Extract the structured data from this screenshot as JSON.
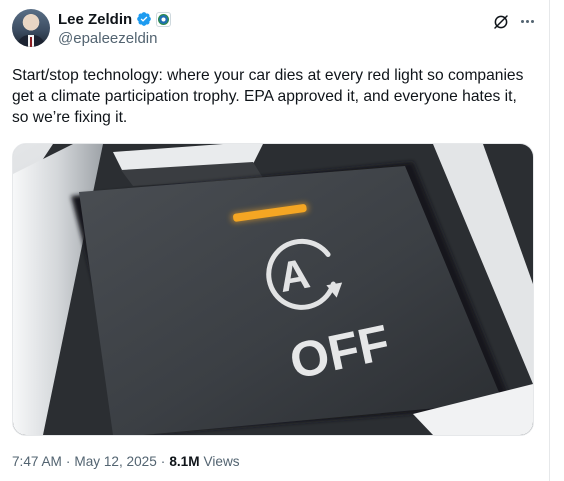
{
  "author": {
    "display_name": "Lee Zeldin",
    "handle": "@epaleezeldin"
  },
  "tweet": {
    "text": "Start/stop technology: where your car dies at every red light so companies get a climate participation trophy. EPA approved it, and everyone hates it, so we’re fixing it."
  },
  "media": {
    "button_label": "OFF",
    "button_symbol": "A",
    "indicator_color": "#f5a623"
  },
  "meta": {
    "time": "7:47 AM",
    "separator": "·",
    "date": "May 12, 2025",
    "views_count": "8.1M",
    "views_label": "Views"
  },
  "colors": {
    "verified": "#1d9bf0",
    "secondary_text": "#536471",
    "primary_text": "#0f1419"
  },
  "icons": [
    "verified-badge-icon",
    "affiliation-seal-icon",
    "grok-icon",
    "more-icon"
  ]
}
